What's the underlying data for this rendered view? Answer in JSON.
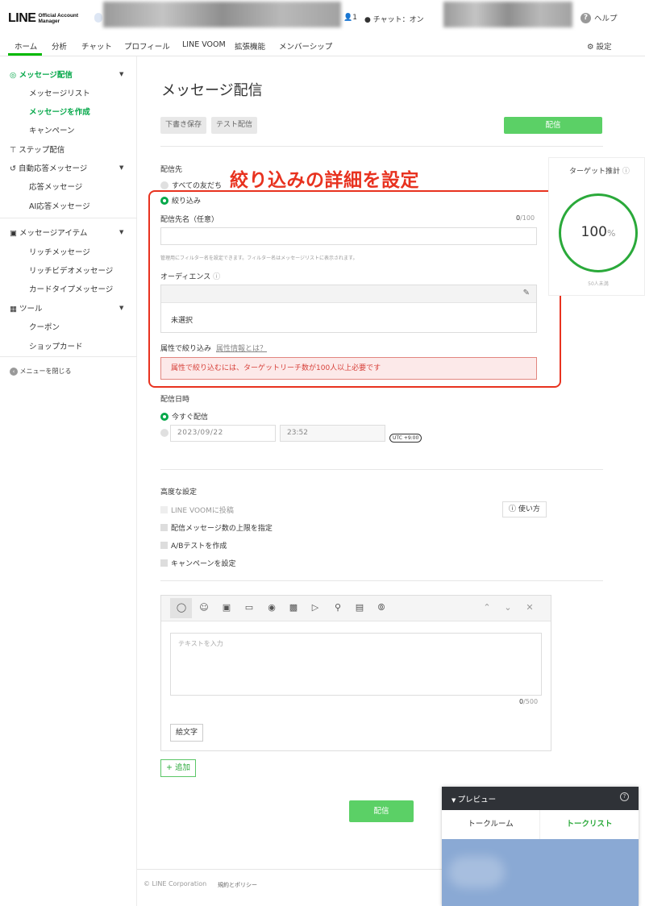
{
  "header": {
    "logo_main": "LINE",
    "logo_sub1": "Official Account",
    "logo_sub2": "Manager",
    "member_count": "1",
    "chat_status": "チャット：オン",
    "help_label": "ヘルプ"
  },
  "nav": {
    "items": [
      "ホーム",
      "分析",
      "チャット",
      "プロフィール",
      "LINE VOOM",
      "拡張機能",
      "メンバーシップ"
    ],
    "settings_label": "設定"
  },
  "sidebar": {
    "message_delivery": "メッセージ配信",
    "message_list": "メッセージリスト",
    "create_message": "メッセージを作成",
    "campaign": "キャンペーン",
    "step_delivery": "ステップ配信",
    "auto_reply": "自動応答メッセージ",
    "reply_message": "応答メッセージ",
    "ai_reply": "AI応答メッセージ",
    "message_items": "メッセージアイテム",
    "rich_message": "リッチメッセージ",
    "rich_video_message": "リッチビデオメッセージ",
    "card_type_message": "カードタイプメッセージ",
    "tools": "ツール",
    "coupon": "クーポン",
    "shop_card": "ショップカード",
    "close_menu": "メニューを閉じる"
  },
  "main": {
    "title": "メッセージ配信",
    "save_draft": "下書き保存",
    "test_send": "テスト配信",
    "send_top": "配信",
    "recipients_label": "配信先",
    "all_friends": "すべての友だち",
    "filter": "絞り込み",
    "recipient_name_label": "配信先名（任意）",
    "name_count": "0",
    "name_max": "/100",
    "filter_hint": "管理用にフィルター名を設定できます。フィルター名はメッセージリストに表示されます。",
    "audience_label": "オーディエンス",
    "audience_value": "未選択",
    "attribute_filter_label": "属性で絞り込み",
    "attribute_info_link": "属性情報とは？",
    "attribute_alert": "属性で絞り込むには、ターゲットリーチ数が100人以上必要です",
    "schedule_label": "配信日時",
    "send_now": "今すぐ配信",
    "date_value": "2023/09/22",
    "time_value": "23:52",
    "timezone": "UTC +9:00",
    "advanced_label": "高度な設定",
    "adv_voom": "LINE VOOMに投稿",
    "adv_limit": "配信メッセージ数の上限を指定",
    "adv_ab": "A/Bテストを作成",
    "adv_campaign": "キャンペーンを設定",
    "usage_label": "使い方",
    "text_placeholder": "テキストを入力",
    "text_count": "0",
    "text_max": "/500",
    "emoji_button": "絵文字",
    "add_button": "+ 追加",
    "send_bottom": "配信"
  },
  "annotation": {
    "text": "絞り込みの詳細を設定"
  },
  "target_panel": {
    "title": "ターゲット推計",
    "percent": "100",
    "percent_unit": "%",
    "sub": "50人未満"
  },
  "preview": {
    "title": "プレビュー",
    "tab_talkroom": "トークルーム",
    "tab_talklist": "トークリスト"
  },
  "footer": {
    "copyright": "© LINE Corporation",
    "policy": "規約とポリシー"
  },
  "colors": {
    "brand_green": "#06a84a",
    "button_green": "#5bd066",
    "annotation_red": "#e8321f",
    "alert_bg": "#fce9e9"
  }
}
